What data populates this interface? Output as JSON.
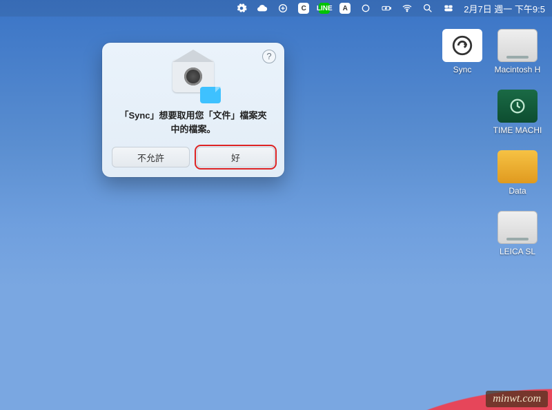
{
  "menubar": {
    "clock": "2月7日 週一 下午9:5"
  },
  "dialog": {
    "message": "「Sync」想要取用您「文件」檔案夾中的檔案。",
    "deny_label": "不允許",
    "allow_label": "好",
    "help_label": "?"
  },
  "desktop_icons": {
    "sync": "Sync",
    "macintosh": "Macintosh H",
    "time_machine": "TIME MACHI",
    "data": "Data",
    "leica": "LEICA SL"
  },
  "watermark": "minwt.com"
}
